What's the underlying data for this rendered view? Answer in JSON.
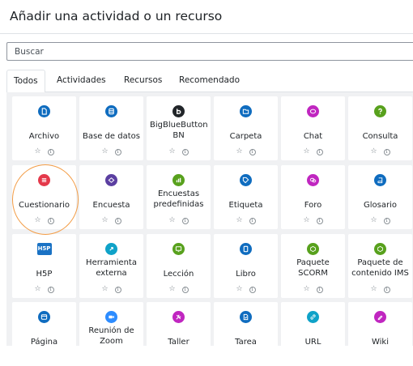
{
  "header": {
    "title": "Añadir una actividad o un recurso"
  },
  "search": {
    "placeholder": "Buscar"
  },
  "tabs": [
    {
      "label": "Todos",
      "active": true
    },
    {
      "label": "Actividades"
    },
    {
      "label": "Recursos"
    },
    {
      "label": "Recomendado"
    }
  ],
  "colors": {
    "blue": "#0f6cbf",
    "purple": "#5b3fa1",
    "pink": "#c026c0",
    "green": "#58a11d",
    "red": "#e4394b",
    "teal": "#0fa2c8",
    "h5p": "#1a72c4"
  },
  "activities": [
    {
      "name": "Archivo",
      "icon": "file-icon",
      "color": "#0f6cbf"
    },
    {
      "name": "Base de datos",
      "icon": "database-icon",
      "color": "#0f6cbf"
    },
    {
      "name": "BigBlueButton BN",
      "icon": "bigbluebutton-icon",
      "color": "#212529"
    },
    {
      "name": "Carpeta",
      "icon": "folder-icon",
      "color": "#0f6cbf"
    },
    {
      "name": "Chat",
      "icon": "chat-icon",
      "color": "#c026c0"
    },
    {
      "name": "Consulta",
      "icon": "choice-icon",
      "color": "#58a11d"
    },
    {
      "name": "Cuestionario",
      "icon": "quiz-icon",
      "color": "#e4394b"
    },
    {
      "name": "Encuesta",
      "icon": "survey-icon",
      "color": "#5b3fa1"
    },
    {
      "name": "Encuestas predefinidas",
      "icon": "feedback-icon",
      "color": "#58a11d"
    },
    {
      "name": "Etiqueta",
      "icon": "label-icon",
      "color": "#0f6cbf"
    },
    {
      "name": "Foro",
      "icon": "forum-icon",
      "color": "#c026c0"
    },
    {
      "name": "Glosario",
      "icon": "glossary-icon",
      "color": "#0f6cbf"
    },
    {
      "name": "H5P",
      "icon": "h5p-icon",
      "color": "#1a72c4"
    },
    {
      "name": "Herramienta externa",
      "icon": "external-tool-icon",
      "color": "#0fa2c8"
    },
    {
      "name": "Lección",
      "icon": "lesson-icon",
      "color": "#58a11d"
    },
    {
      "name": "Libro",
      "icon": "book-icon",
      "color": "#0f6cbf"
    },
    {
      "name": "Paquete SCORM",
      "icon": "scorm-icon",
      "color": "#58a11d"
    },
    {
      "name": "Paquete de contenido IMS",
      "icon": "ims-icon",
      "color": "#58a11d"
    },
    {
      "name": "Página",
      "icon": "page-icon",
      "color": "#0f6cbf"
    },
    {
      "name": "Reunión de Zoom",
      "icon": "zoom-icon",
      "color": "#2d8cff"
    },
    {
      "name": "Taller",
      "icon": "workshop-icon",
      "color": "#c026c0"
    },
    {
      "name": "Tarea",
      "icon": "assignment-icon",
      "color": "#0f6cbf"
    },
    {
      "name": "URL",
      "icon": "url-icon",
      "color": "#0fa2c8"
    },
    {
      "name": "Wiki",
      "icon": "wiki-icon",
      "color": "#c026c0"
    }
  ],
  "card_actions": {
    "star": "☆",
    "info": "i"
  }
}
